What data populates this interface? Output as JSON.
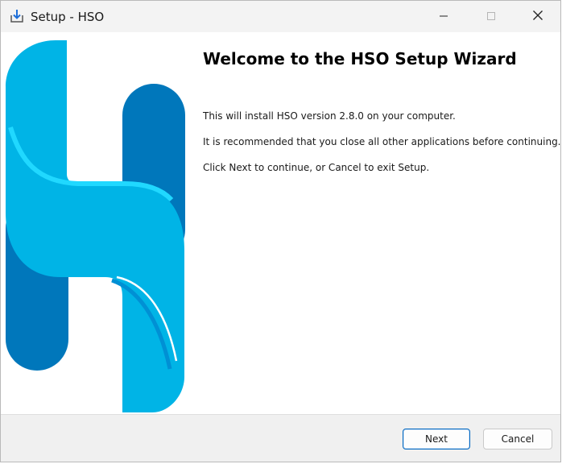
{
  "window": {
    "title": "Setup - HSO",
    "icon": "installer-download-icon"
  },
  "controls": {
    "minimize_icon": "minimize-icon",
    "maximize_icon": "maximize-icon",
    "close_icon": "close-icon"
  },
  "logo": {
    "name": "hso-logo",
    "colors": {
      "light_blue": "#00b4e6",
      "dark_blue": "#0077bb",
      "highlight": "#20d8ff"
    }
  },
  "main": {
    "title": "Welcome to the HSO Setup Wizard",
    "paragraphs": [
      "This will install HSO version 2.8.0 on your computer.",
      "It is recommended that you close all other applications before continuing.",
      "Click Next to continue, or Cancel to exit Setup."
    ]
  },
  "footer": {
    "next_label": "Next",
    "cancel_label": "Cancel",
    "accent": "#0067c0"
  }
}
